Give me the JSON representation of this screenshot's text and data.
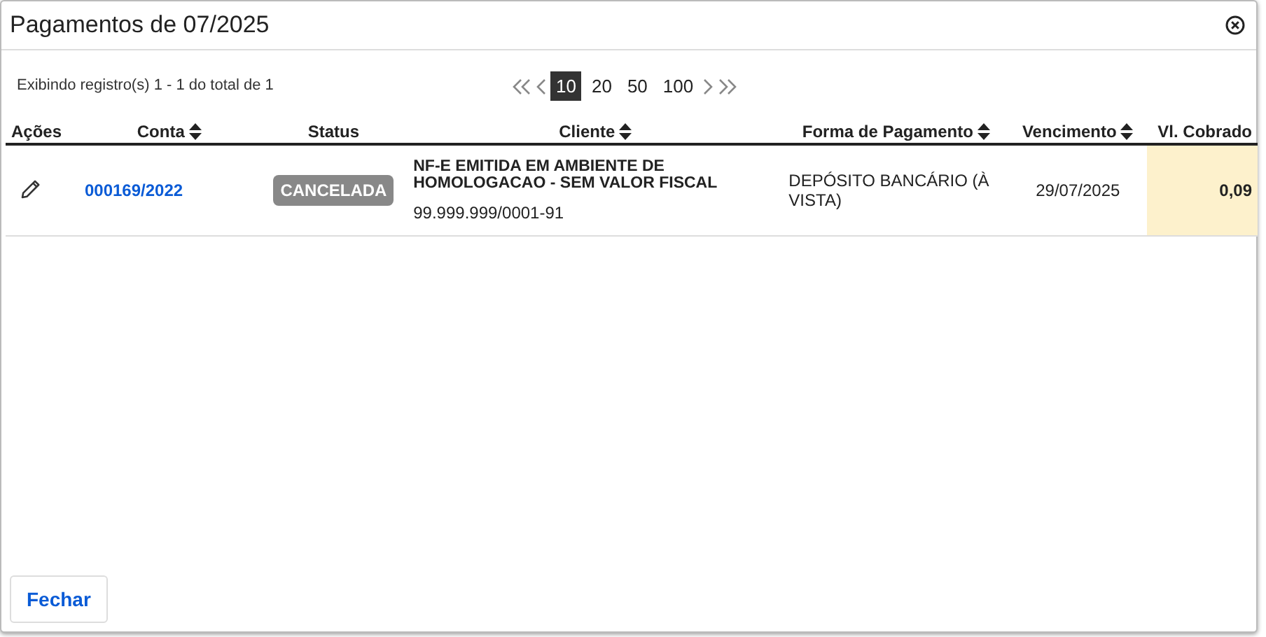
{
  "dialog": {
    "title": "Pagamentos de 07/2025"
  },
  "summary": "Exibindo registro(s) 1 - 1 do total de 1",
  "page_sizes": [
    {
      "label": "10",
      "selected": true
    },
    {
      "label": "20",
      "selected": false
    },
    {
      "label": "50",
      "selected": false
    },
    {
      "label": "100",
      "selected": false
    }
  ],
  "columns": [
    {
      "label": "Ações",
      "sortable": false
    },
    {
      "label": "Conta",
      "sortable": true
    },
    {
      "label": "Status",
      "sortable": false
    },
    {
      "label": "Cliente",
      "sortable": true
    },
    {
      "label": "Forma de Pagamento",
      "sortable": true
    },
    {
      "label": "Vencimento",
      "sortable": true
    },
    {
      "label": "Vl. Cobrado",
      "sortable": false
    }
  ],
  "rows": [
    {
      "conta": "000169/2022",
      "status": "CANCELADA",
      "cliente": "NF-E EMITIDA EM AMBIENTE DE HOMOLOGACAO - SEM VALOR FISCAL",
      "cliente_doc": "99.999.999/0001-91",
      "forma": "DEPÓSITO BANCÁRIO (À VISTA)",
      "vencimento": "29/07/2025",
      "valor": "0,09"
    }
  ],
  "buttons": [
    "Fechar"
  ]
}
